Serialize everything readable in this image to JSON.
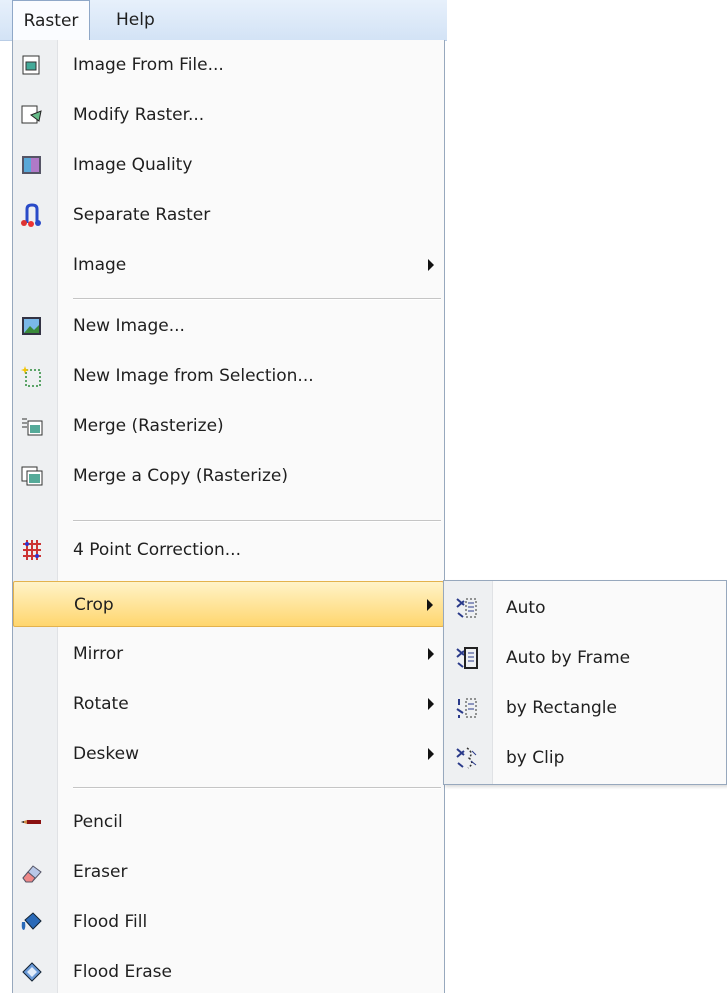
{
  "menubar": {
    "items": [
      "Raster",
      "Help"
    ]
  },
  "menu": {
    "items": [
      {
        "label": "Image From File...",
        "icon": "image-from-file-icon"
      },
      {
        "label": "Modify Raster...",
        "icon": "modify-raster-icon"
      },
      {
        "label": "Image Quality",
        "icon": "image-quality-icon"
      },
      {
        "label": "Separate Raster",
        "icon": "separate-raster-icon"
      },
      {
        "label": "Image",
        "submenu": true
      },
      {
        "label": "New Image...",
        "icon": "new-image-icon"
      },
      {
        "label": "New Image from Selection...",
        "icon": "new-image-from-selection-icon"
      },
      {
        "label": "Merge (Rasterize)",
        "icon": "merge-rasterize-icon"
      },
      {
        "label": "Merge a Copy (Rasterize)",
        "icon": "merge-copy-icon"
      },
      {
        "label": "4 Point Correction...",
        "icon": "four-point-correction-icon"
      },
      {
        "label": "Crop",
        "submenu": true,
        "highlighted": true
      },
      {
        "label": "Mirror",
        "submenu": true
      },
      {
        "label": "Rotate",
        "submenu": true
      },
      {
        "label": "Deskew",
        "submenu": true
      },
      {
        "label": "Pencil",
        "icon": "pencil-icon"
      },
      {
        "label": "Eraser",
        "icon": "eraser-icon"
      },
      {
        "label": "Flood Fill",
        "icon": "flood-fill-icon"
      },
      {
        "label": "Flood Erase",
        "icon": "flood-erase-icon"
      }
    ]
  },
  "submenu": {
    "items": [
      {
        "label": "Auto",
        "icon": "crop-auto-icon"
      },
      {
        "label": "Auto by Frame",
        "icon": "crop-auto-by-frame-icon"
      },
      {
        "label": "by Rectangle",
        "icon": "crop-by-rectangle-icon"
      },
      {
        "label": "by Clip",
        "icon": "crop-by-clip-icon"
      }
    ]
  },
  "colors": {
    "highlight": "#ffd66e",
    "menubar": "#d3e3f6",
    "gutter": "#eef0f2"
  }
}
